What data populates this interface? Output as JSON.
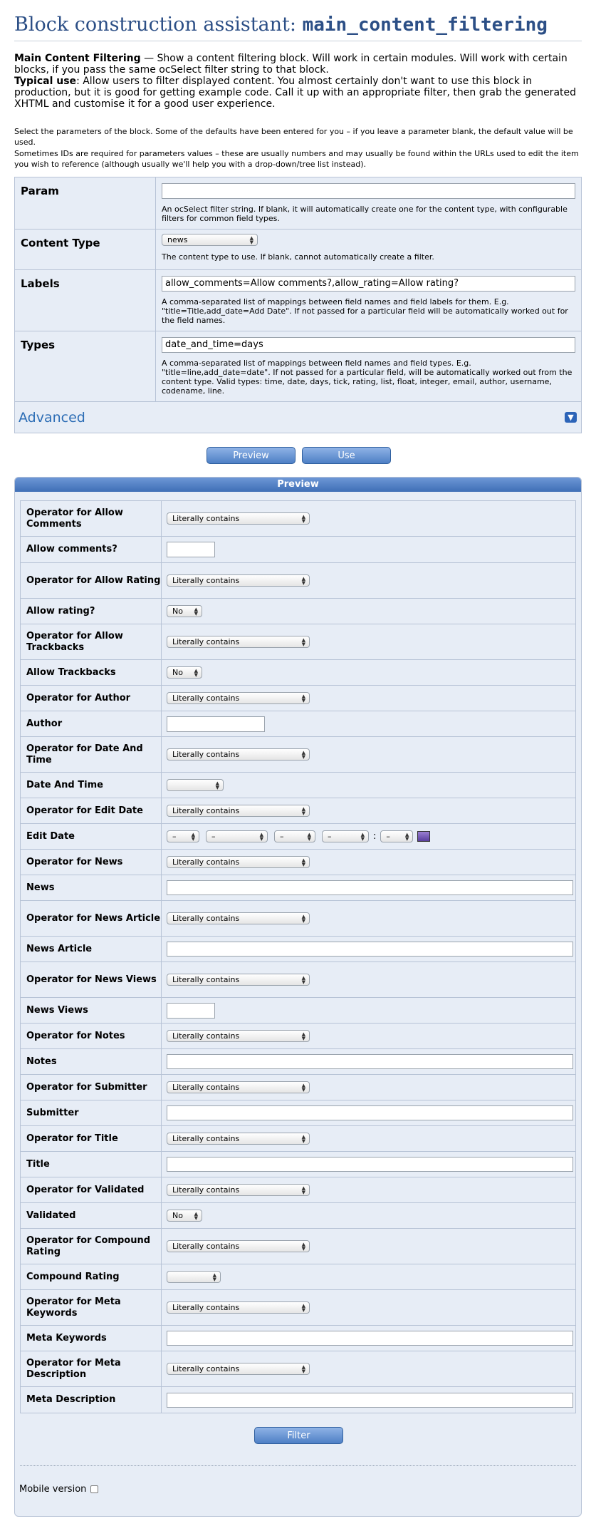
{
  "header": {
    "title_prefix": "Block construction assistant: ",
    "title_code": "main_content_filtering"
  },
  "intro": {
    "block_name": "Main Content Filtering",
    "block_desc": " — Show a content filtering block. Will work in certain modules. Will work with certain blocks, if you pass the same ocSelect filter string to that block.",
    "typical_label": "Typical use",
    "typical_desc": ": Allow users to filter displayed content. You almost certainly don't want to use this block in production, but it is good for getting example code. Call it up with an appropriate filter, then grab the generated XHTML and customise it for a good user experience."
  },
  "notes": {
    "select_params": "Select the parameters of the block. Some of the defaults have been entered for you – if you leave a parameter blank, the default value will be used.",
    "ids_note": "Sometimes IDs are required for parameters values – these are usually numbers and may usually be found within the URLs used to edit the item you wish to reference (although usually we'll help you with a drop-down/tree list instead)."
  },
  "params": {
    "param_label": "Param",
    "param_value": "",
    "param_desc": "An ocSelect filter string. If blank, it will automatically create one for the content type, with configurable filters for common field types.",
    "content_type_label": "Content Type",
    "content_type_value": "news",
    "content_type_desc": "The content type to use. If blank, cannot automatically create a filter.",
    "labels_label": "Labels",
    "labels_value": "allow_comments=Allow comments?,allow_rating=Allow rating?",
    "labels_desc": "A comma-separated list of mappings between field names and field labels for them. E.g. \"title=Title,add_date=Add Date\". If not passed for a particular field will be automatically worked out for the field names.",
    "types_label": "Types",
    "types_value": "date_and_time=days",
    "types_desc": "A comma-separated list of mappings between field names and field types. E.g. \"title=line,add_date=date\". If not passed for a particular field, will be automatically worked out from the content type. Valid types: time, date, days, tick, rating, list, float, integer, email, author, username, codename, line.",
    "advanced_label": "Advanced",
    "advanced_icon": "expand-icon"
  },
  "buttons": {
    "preview": "Preview",
    "use": "Use",
    "filter": "Filter"
  },
  "preview": {
    "header": "Preview",
    "operator_default": "Literally contains",
    "no_value": "No",
    "date_placeholder": "–",
    "colon": ":",
    "rows": {
      "op_allow_comments": "Operator for Allow Comments",
      "allow_comments": "Allow comments?",
      "op_allow_rating": "Operator for Allow Rating",
      "allow_rating": "Allow rating?",
      "op_allow_trackbacks": "Operator for Allow Trackbacks",
      "allow_trackbacks": "Allow Trackbacks",
      "op_author": "Operator for Author",
      "author": "Author",
      "op_date_and_time": "Operator for Date And Time",
      "date_and_time": "Date And Time",
      "op_edit_date": "Operator for Edit Date",
      "edit_date": "Edit Date",
      "op_news": "Operator for News",
      "news": "News",
      "op_news_article": "Operator for News Article",
      "news_article": "News Article",
      "op_news_views": "Operator for News Views",
      "news_views": "News Views",
      "op_notes": "Operator for Notes",
      "notes": "Notes",
      "op_submitter": "Operator for Submitter",
      "submitter": "Submitter",
      "op_title": "Operator for Title",
      "title": "Title",
      "op_validated": "Operator for Validated",
      "validated": "Validated",
      "op_compound_rating": "Operator for Compound Rating",
      "compound_rating": "Compound Rating",
      "op_meta_keywords": "Operator for Meta Keywords",
      "meta_keywords": "Meta Keywords",
      "op_meta_description": "Operator for Meta Description",
      "meta_description": "Meta Description"
    }
  },
  "footer": {
    "mobile_version": "Mobile version"
  },
  "colors": {
    "accent": "#2c4f86",
    "panel": "#e7edf6",
    "border": "#b7c3d6",
    "button": "#4d7fc5"
  }
}
